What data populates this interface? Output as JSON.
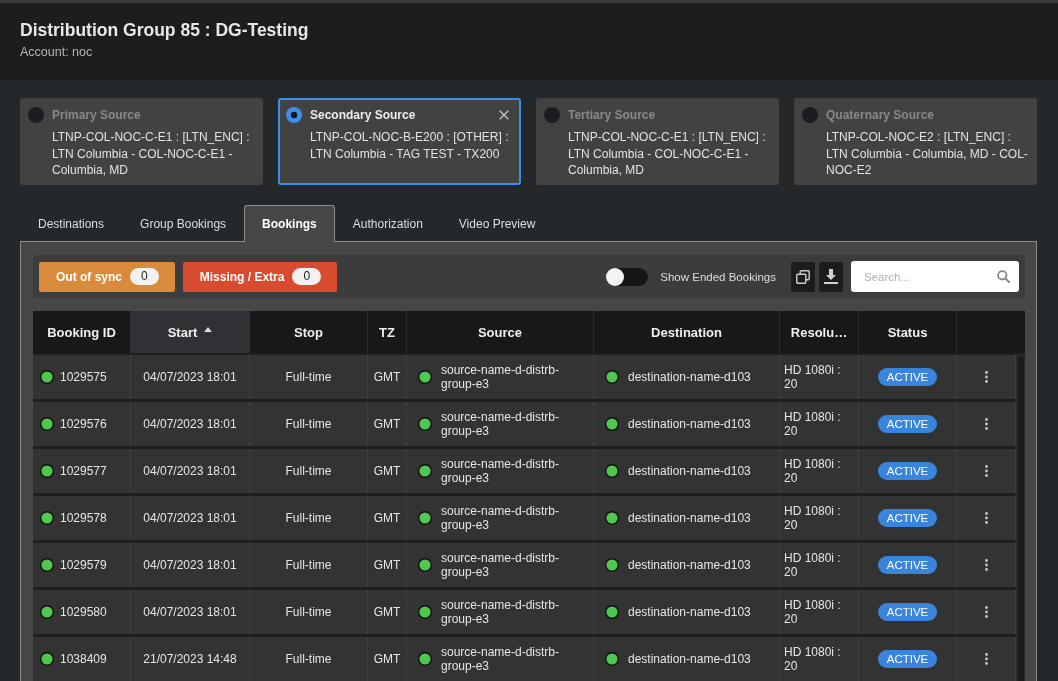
{
  "header": {
    "title": "Distribution Group 85 : DG-Testing",
    "account": "Account: noc"
  },
  "sources": [
    {
      "title": "Primary Source",
      "description": "LTNP-COL-NOC-C-E1 : [LTN_ENC] : LTN Columbia - COL-NOC-C-E1 - Columbia, MD",
      "selected": false
    },
    {
      "title": "Secondary Source",
      "description": "LTNP-COL-NOC-B-E200 : [OTHER] : LTN Columbia - TAG TEST - TX200",
      "selected": true
    },
    {
      "title": "Tertiary Source",
      "description": "LTNP-COL-NOC-C-E1 : [LTN_ENC] : LTN Columbia - COL-NOC-C-E1 - Columbia, MD",
      "selected": false
    },
    {
      "title": "Quaternary Source",
      "description": "LTNP-COL-NOC-E2 : [LTN_ENC] : LTN Columbia - Columbia, MD - COL-NOC-E2",
      "selected": false
    }
  ],
  "tabs": [
    {
      "label": "Destinations",
      "selected": false
    },
    {
      "label": "Group Bookings",
      "selected": false
    },
    {
      "label": "Bookings",
      "selected": true
    },
    {
      "label": "Authorization",
      "selected": false
    },
    {
      "label": "Video Preview",
      "selected": false
    }
  ],
  "toolbar": {
    "filters": [
      {
        "kind": "warning",
        "label": "Out of sync",
        "count": "0"
      },
      {
        "kind": "error",
        "label": "Missing / Extra",
        "count": "0"
      }
    ],
    "show_ended": {
      "label": "Show Ended Bookings",
      "on": false
    },
    "search": {
      "placeholder": "Search..."
    }
  },
  "table": {
    "columns": [
      {
        "label": "Booking ID",
        "sorted": false
      },
      {
        "label": "Start",
        "sorted": true
      },
      {
        "label": "Stop",
        "sorted": false
      },
      {
        "label": "TZ",
        "sorted": false
      },
      {
        "label": "Source",
        "sorted": false
      },
      {
        "label": "Destination",
        "sorted": false
      },
      {
        "label": "Resolu…",
        "sorted": false
      },
      {
        "label": "Status",
        "sorted": false
      }
    ],
    "rows": [
      {
        "booking_id": "1029575",
        "start": "04/07/2023 18:01",
        "stop": "Full-time",
        "tz": "GMT",
        "source": "source-name-d-distrb-group-e3",
        "destination": "destination-name-d103",
        "resolution": "HD 1080i : 20",
        "status": "ACTIVE"
      },
      {
        "booking_id": "1029576",
        "start": "04/07/2023 18:01",
        "stop": "Full-time",
        "tz": "GMT",
        "source": "source-name-d-distrb-group-e3",
        "destination": "destination-name-d103",
        "resolution": "HD 1080i : 20",
        "status": "ACTIVE"
      },
      {
        "booking_id": "1029577",
        "start": "04/07/2023 18:01",
        "stop": "Full-time",
        "tz": "GMT",
        "source": "source-name-d-distrb-group-e3",
        "destination": "destination-name-d103",
        "resolution": "HD 1080i : 20",
        "status": "ACTIVE"
      },
      {
        "booking_id": "1029578",
        "start": "04/07/2023 18:01",
        "stop": "Full-time",
        "tz": "GMT",
        "source": "source-name-d-distrb-group-e3",
        "destination": "destination-name-d103",
        "resolution": "HD 1080i : 20",
        "status": "ACTIVE"
      },
      {
        "booking_id": "1029579",
        "start": "04/07/2023 18:01",
        "stop": "Full-time",
        "tz": "GMT",
        "source": "source-name-d-distrb-group-e3",
        "destination": "destination-name-d103",
        "resolution": "HD 1080i : 20",
        "status": "ACTIVE"
      },
      {
        "booking_id": "1029580",
        "start": "04/07/2023 18:01",
        "stop": "Full-time",
        "tz": "GMT",
        "source": "source-name-d-distrb-group-e3",
        "destination": "destination-name-d103",
        "resolution": "HD 1080i : 20",
        "status": "ACTIVE"
      },
      {
        "booking_id": "1038409",
        "start": "21/07/2023 14:48",
        "stop": "Full-time",
        "tz": "GMT",
        "source": "source-name-d-distrb-group-e3",
        "destination": "destination-name-d103",
        "resolution": "HD 1080i : 20",
        "status": "ACTIVE"
      }
    ]
  }
}
